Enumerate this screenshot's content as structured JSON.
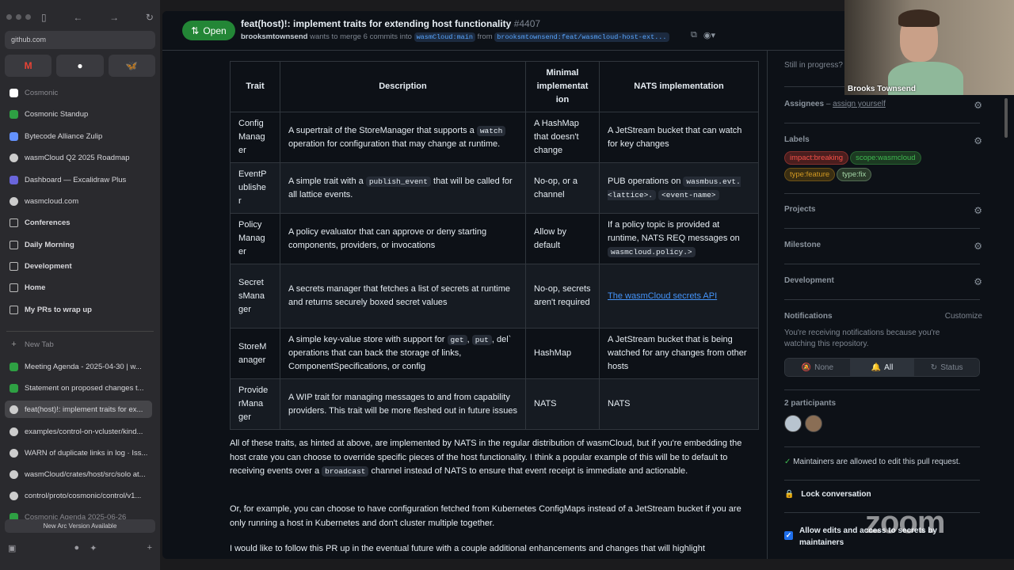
{
  "sidebar": {
    "url": "github.com",
    "items": [
      {
        "label": "Cosmonic",
        "icon": "cosmonic-icon",
        "color": "#ffffff",
        "dim": true
      },
      {
        "label": "Cosmonic Standup",
        "icon": "cosmonic-icon",
        "color": "#2ea043"
      },
      {
        "label": "Bytecode Alliance Zulip",
        "icon": "zulip-icon",
        "color": "#6492fe"
      },
      {
        "label": "wasmCloud Q2 2025 Roadmap",
        "icon": "github-icon",
        "color": "#cccccc"
      },
      {
        "label": "Dashboard — Excalidraw Plus",
        "icon": "excalidraw-icon",
        "color": "#6965db"
      },
      {
        "label": "wasmcloud.com",
        "icon": "github-icon",
        "color": "#cccccc"
      },
      {
        "label": "Conferences",
        "icon": "folder-icon",
        "folder": true
      },
      {
        "label": "Daily Morning",
        "icon": "folder-icon",
        "folder": true
      },
      {
        "label": "Development",
        "icon": "folder-icon",
        "folder": true
      },
      {
        "label": "Home",
        "icon": "folder-icon",
        "folder": true
      },
      {
        "label": "My PRs to wrap up",
        "icon": "folder-icon",
        "folder": true
      },
      {
        "label": "New Tab",
        "icon": "plus-icon",
        "dim": true
      },
      {
        "label": "Meeting Agenda - 2025-04-30 | w...",
        "icon": "cosmonic-icon",
        "color": "#2ea043"
      },
      {
        "label": "Statement on proposed changes t...",
        "icon": "cosmonic-icon",
        "color": "#2ea043"
      },
      {
        "label": "feat(host)!: implement traits for ex...",
        "icon": "github-icon",
        "color": "#cccccc",
        "active": true
      },
      {
        "label": "examples/control-on-vcluster/kind...",
        "icon": "github-icon",
        "color": "#cccccc"
      },
      {
        "label": "WARN of duplicate links in log · Iss...",
        "icon": "github-icon",
        "color": "#cccccc"
      },
      {
        "label": "wasmCloud/crates/host/src/solo at...",
        "icon": "github-icon",
        "color": "#cccccc"
      },
      {
        "label": "control/proto/cosmonic/control/v1...",
        "icon": "github-icon",
        "color": "#cccccc"
      },
      {
        "label": "Cosmonic Agenda 2025-06-26",
        "icon": "cosmonic-icon",
        "color": "#2ea043",
        "dim": true
      }
    ],
    "new_arc": "New Arc Version Available"
  },
  "header": {
    "state": "Open",
    "title": "feat(host)!: implement traits for extending host functionality",
    "number": "#4407",
    "author": "brooksmtownsend",
    "merge_text": "wants to merge 6 commits into",
    "base": "wasmCloud:main",
    "from": "from",
    "head": "brooksmtownsend:feat/wasmcloud-host-ext..."
  },
  "table": {
    "headers": [
      "Trait",
      "Description",
      "Minimal implementation",
      "NATS implementation"
    ],
    "header_display": [
      "Trait",
      "Description",
      "Minimal\nimplementat\nion",
      "NATS implementation"
    ],
    "rows": [
      {
        "trait": "Config\nManag\ner",
        "desc": [
          {
            "t": "A supertrait of the StoreManager that supports a "
          },
          {
            "c": "watch"
          },
          {
            "t": " operation for configuration that may change at runtime."
          }
        ],
        "minimal": "A HashMap that doesn't change",
        "nats": [
          {
            "t": "A JetStream bucket that can watch for key changes"
          }
        ]
      },
      {
        "trait": "EventP\nublishe\nr",
        "desc": [
          {
            "t": "A simple trait with a "
          },
          {
            "c": "publish_event"
          },
          {
            "t": " that will be called for all lattice events."
          }
        ],
        "minimal": "No-op, or a channel",
        "nats": [
          {
            "t": "PUB operations on "
          },
          {
            "c": "wasmbus.evt.<lattice>."
          },
          {
            "t": " "
          },
          {
            "c": "<event-name>"
          }
        ]
      },
      {
        "trait": "Policy\nManag\ner",
        "desc": [
          {
            "t": "A policy evaluator that can approve or deny starting components, providers, or invocations"
          }
        ],
        "minimal": "Allow by default",
        "nats": [
          {
            "t": "If a policy topic is provided at runtime, NATS REQ messages on "
          },
          {
            "c": "wasmcloud.policy.>"
          }
        ]
      },
      {
        "trait": "Secret\nsMana\nger",
        "desc": [
          {
            "t": "A secrets manager that fetches a list of secrets at runtime and returns securely boxed secret values"
          }
        ],
        "minimal": "No-op, secrets aren't required",
        "nats": [
          {
            "a": "The wasmCloud secrets API"
          }
        ]
      },
      {
        "trait": "StoreM\nanager",
        "desc": [
          {
            "t": "A simple key-value store with support for "
          },
          {
            "c": "get"
          },
          {
            "t": ", "
          },
          {
            "c": "put"
          },
          {
            "t": ", del` operations that can back the storage of links, ComponentSpecifications, or config"
          }
        ],
        "minimal": "HashMap",
        "nats": [
          {
            "t": "A JetStream bucket that is being watched for any changes from other hosts"
          }
        ]
      },
      {
        "trait": "Provide\nrMana\nger",
        "desc": [
          {
            "t": "A WIP trait for managing messages to and from capability providers. This trait will be more fleshed out in future issues"
          }
        ],
        "minimal": "NATS",
        "nats": [
          {
            "t": "NATS"
          }
        ]
      }
    ]
  },
  "body": {
    "p1_a": "All of these traits, as hinted at above, are implemented by NATS in the regular distribution of wasmCloud, but if you're embedding the host crate you can choose to override specific pieces of the host functionality. I think a popular example of this will be to default to receiving events over a ",
    "p1_code": "broadcast",
    "p1_b": " channel instead of NATS to ensure that event receipt is immediate and actionable.",
    "p2": "Or, for example, you can choose to have configuration fetched from Kubernetes ConfigMaps instead of a JetStream bucket if you are only running a host in Kubernetes and don't cluster multiple together.",
    "p3": "I would like to follow this PR up in the eventual future with a couple additional enhancements and changes that will highlight"
  },
  "right": {
    "still": "Still in progress?",
    "assignees": "Assignees",
    "assign_sep": "–",
    "assign_yourself": "assign yourself",
    "labels_title": "Labels",
    "labels": [
      {
        "name": "impact:breaking",
        "color": "#f85149",
        "bg": "#4a1e1e"
      },
      {
        "name": "scope:wasmcloud",
        "color": "#3fb950",
        "bg": "#1c3a22"
      },
      {
        "name": "type:feature",
        "color": "#d29922",
        "bg": "#3a2e12"
      },
      {
        "name": "type:fix",
        "color": "#a5d6a7",
        "bg": "#2a3a2a"
      }
    ],
    "projects": "Projects",
    "milestone": "Milestone",
    "development": "Development",
    "notifications": "Notifications",
    "customize": "Customize",
    "notif_text": "You're receiving notifications because you're watching this repository.",
    "notif_none": "None",
    "notif_all": "All",
    "notif_status": "Status",
    "participants": "2 participants",
    "maintainers": "Maintainers are allowed to edit this pull request.",
    "lock": "Lock conversation",
    "allow_edits": "Allow edits and access to secrets by maintainers"
  },
  "webcam": {
    "name": "Brooks Townsend"
  },
  "zoom": "zoom"
}
